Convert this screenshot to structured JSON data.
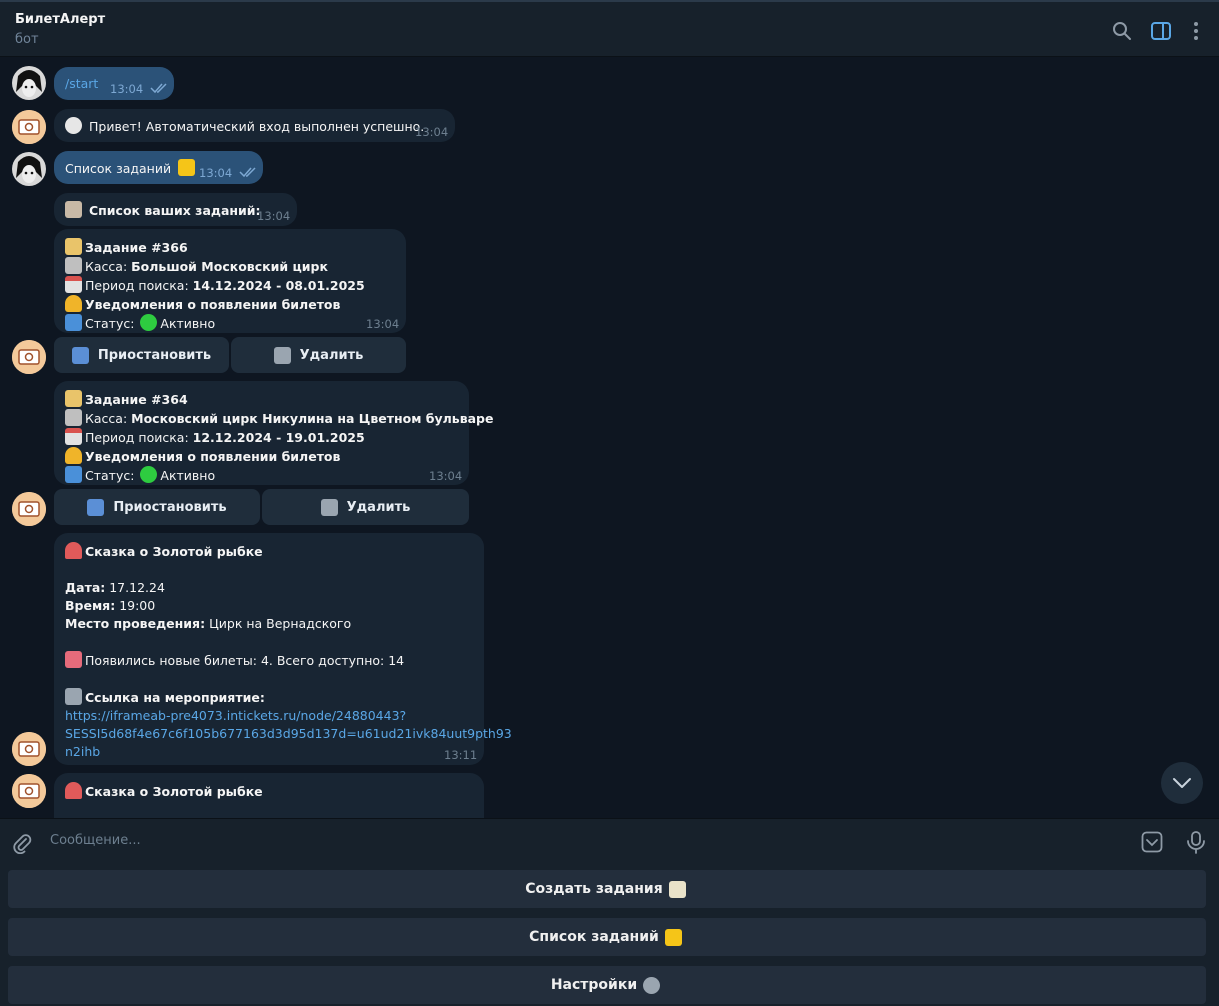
{
  "header": {
    "title": "БилетАлерт",
    "subtitle": "бот"
  },
  "messages": {
    "m1": {
      "text": "/start",
      "time": "13:04"
    },
    "m2": {
      "text": "Привет! Автоматический вход выполнен успешно.",
      "time": "13:04"
    },
    "m3": {
      "text": "Список заданий",
      "time": "13:04"
    },
    "m4": {
      "text": "Список ваших заданий:",
      "time": "13:04"
    },
    "task1": {
      "title": "Задание #366",
      "kassa_label": "Касса:",
      "kassa_value": "Большой Московский цирк",
      "period_label": "Период поиска:",
      "period_value": "14.12.2024 - 08.01.2025",
      "notify": "Уведомления о появлении билетов",
      "status_label": "Статус:",
      "status_value": "Активно",
      "time": "13:04",
      "pause_label": "Приостановить",
      "delete_label": "Удалить"
    },
    "task2": {
      "title": "Задание #364",
      "kassa_label": "Касса:",
      "kassa_value": "Московский цирк Никулина на Цветном бульваре",
      "period_label": "Период поиска:",
      "period_value": "12.12.2024 - 19.01.2025",
      "notify": "Уведомления о появлении билетов",
      "status_label": "Статус:",
      "status_value": "Активно",
      "time": "13:04",
      "pause_label": "Приостановить",
      "delete_label": "Удалить"
    },
    "event1": {
      "title": "Сказка о Золотой рыбке",
      "date_label": "Дата:",
      "date_value": "17.12.24",
      "time_label": "Время:",
      "time_value": "19:00",
      "place_label": "Место проведения:",
      "place_value": "Цирк на Вернадского",
      "tickets": "Появились новые билеты: 4. Всего доступно: 14",
      "link_label": "Ссылка на мероприятие:",
      "link_line1": "https://iframeab-pre4073.intickets.ru/node/24880443?",
      "link_line2": "SESSI5d68f4e67c6f105b677163d3d95d137d=u61ud21ivk84uut9pth93",
      "link_line3": "n2ihb",
      "time": "13:11"
    },
    "event2": {
      "title": "Сказка о Золотой рыбке"
    }
  },
  "composer": {
    "placeholder": "Сообщение..."
  },
  "keyboard": {
    "create": "Создать задания",
    "list": "Список заданий",
    "settings": "Настройки"
  },
  "icons": [
    "search-icon",
    "sidebar-toggle-icon",
    "more-icon",
    "attach-icon",
    "emoji-icon",
    "mic-icon",
    "chevron-down-icon"
  ],
  "colors": {
    "background": "#0e1621",
    "outgoing": "#2b5278",
    "incoming": "#182533",
    "link": "#5aa7e6",
    "accent": "#5aa7e6"
  }
}
